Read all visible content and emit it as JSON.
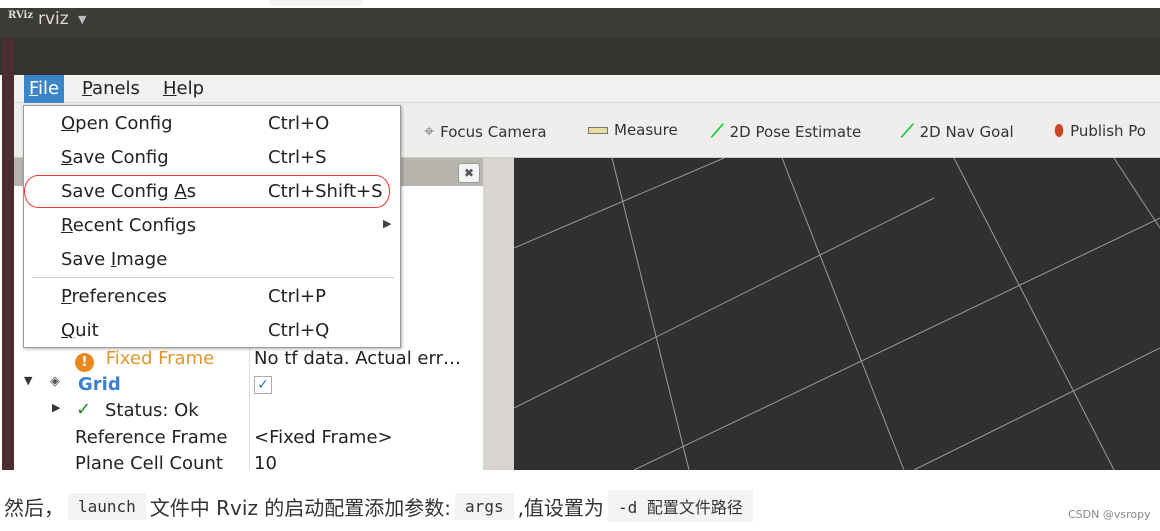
{
  "window": {
    "logo": "RViz",
    "title": "rviz"
  },
  "menubar": [
    {
      "label": "File",
      "key": "F",
      "rest": "ile"
    },
    {
      "label": "Panels",
      "key": "P",
      "rest": "anels"
    },
    {
      "label": "Help",
      "key": "H",
      "rest": "elp"
    }
  ],
  "toolbar": [
    {
      "label": "Focus Camera",
      "icon": "crosshair-icon"
    },
    {
      "label": "Measure",
      "icon": "ruler-icon"
    },
    {
      "label": "2D Pose Estimate",
      "icon": "green-arrow-icon"
    },
    {
      "label": "2D Nav Goal",
      "icon": "green-arrow-icon"
    },
    {
      "label": "Publish Po",
      "icon": "map-pin-icon"
    }
  ],
  "file_menu": [
    {
      "pre": "",
      "key": "O",
      "post": "pen Config",
      "shortcut": "Ctrl+O"
    },
    {
      "pre": "",
      "key": "S",
      "post": "ave Config",
      "shortcut": "Ctrl+S"
    },
    {
      "pre": "Save Config ",
      "key": "A",
      "post": "s",
      "shortcut": "Ctrl+Shift+S"
    },
    {
      "pre": "",
      "key": "R",
      "post": "ecent Configs",
      "shortcut": ""
    },
    {
      "pre": "Save ",
      "key": "I",
      "post": "mage",
      "shortcut": ""
    },
    {
      "pre": "",
      "key": "P",
      "post": "references",
      "shortcut": "Ctrl+P"
    },
    {
      "pre": "",
      "key": "Q",
      "post": "uit",
      "shortcut": "Ctrl+Q"
    }
  ],
  "displays": {
    "fixed_frame": {
      "label": "Fixed Frame",
      "value": "No tf data.  Actual err…"
    },
    "grid": {
      "label": "Grid",
      "checked": true,
      "check": "✓"
    },
    "status": {
      "label": "Status: Ok"
    },
    "reference_frame": {
      "label": "Reference Frame",
      "value": "<Fixed Frame>"
    },
    "plane_cell_count": {
      "label": "Plane Cell Count",
      "value": "10"
    }
  },
  "caption": {
    "t1": "然后，",
    "c1": "launch",
    "t2": "文件中 Rviz 的启动配置添加参数:",
    "c2": "args",
    "t3": ",值设置为",
    "c3": "-d 配置文件路径"
  },
  "watermark": "CSDN @vsropy",
  "colors": {
    "menu_highlight": "#3b86c8",
    "warning": "#e8891e",
    "grid_label": "#3a7fd0",
    "annotation": "#e33333"
  }
}
